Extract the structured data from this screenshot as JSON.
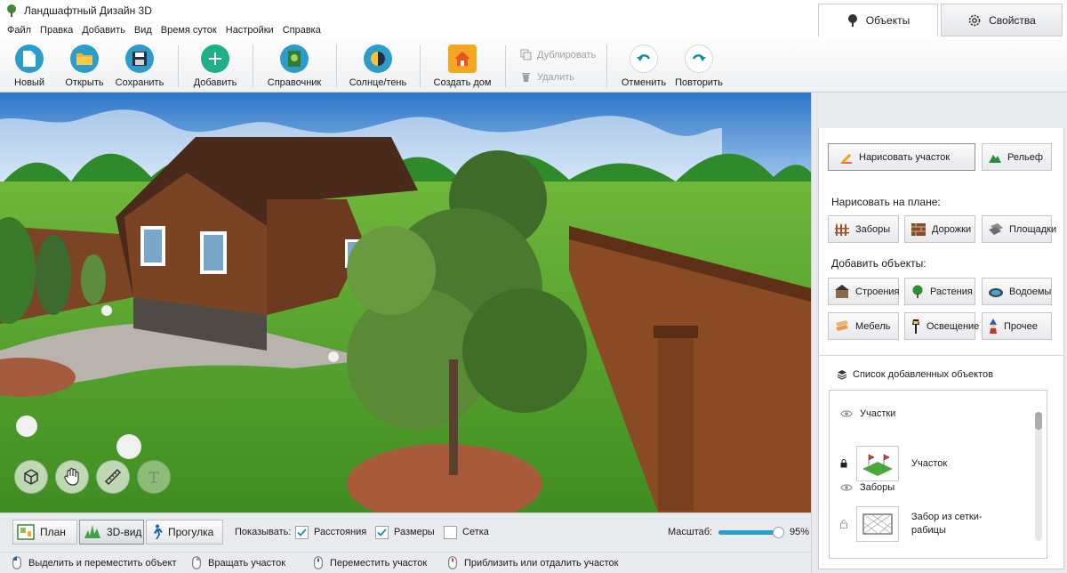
{
  "window": {
    "title": "Ландшафтный Дизайн 3D",
    "controls": [
      "—",
      "☐",
      "✕"
    ]
  },
  "menu": [
    "Файл",
    "Правка",
    "Добавить",
    "Вид",
    "Время суток",
    "Настройки",
    "Справка"
  ],
  "toolbar": {
    "new": "Новый",
    "open": "Открыть",
    "save": "Сохранить",
    "add": "Добавить",
    "reference": "Справочник",
    "sun_shadow": "Солнце/тень",
    "create_house": "Создать дом",
    "duplicate": "Дублировать",
    "delete": "Удалить",
    "undo": "Отменить",
    "redo": "Повторить"
  },
  "tabs": {
    "objects": "Объекты",
    "properties": "Свойства"
  },
  "panel": {
    "draw_plot": "Нарисовать участок",
    "relief": "Рельеф",
    "draw_on_plan_label": "Нарисовать на плане:",
    "draw_items": [
      "Заборы",
      "Дорожки",
      "Площадки"
    ],
    "add_objects_label": "Добавить объекты:",
    "add_items_row1": [
      "Строения",
      "Растения",
      "Водоемы"
    ],
    "add_items_row2": [
      "Мебель",
      "Освещение",
      "Прочее"
    ],
    "object_list_label": "Список добавленных объектов",
    "object_list": {
      "group1": "Участки",
      "item1": "Участок",
      "group2": "Заборы",
      "item2": "Забор из сетки-рабицы"
    }
  },
  "view_modes": {
    "plan": "План",
    "view3d": "3D-вид",
    "walk": "Прогулка",
    "active": "3D-вид"
  },
  "show": {
    "label": "Показывать:",
    "distances": "Расстояния",
    "distances_checked": true,
    "dimensions": "Размеры",
    "dimensions_checked": true,
    "grid": "Сетка",
    "grid_checked": false
  },
  "scale": {
    "label": "Масштаб:",
    "value": 95,
    "text": "95%"
  },
  "status": [
    "Выделить и переместить объект",
    "Вращать участок",
    "Переместить участок",
    "Приблизить или отдалить участок"
  ],
  "colors": {
    "accent": "#2e9cc8",
    "grass": "#56a52c",
    "brick": "#6b3a1f",
    "roof": "#4a2a1a"
  }
}
